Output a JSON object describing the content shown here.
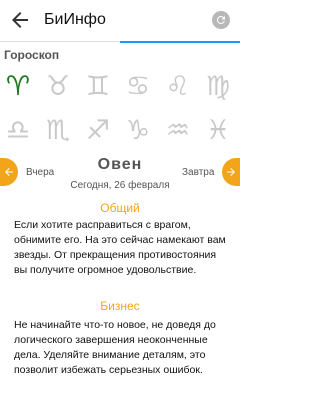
{
  "app": {
    "title": "БиИнфо"
  },
  "zodiac_section": {
    "title": "Гороскоп"
  },
  "zodiac_row1": [
    {
      "name": "aries",
      "glyph": "♈"
    },
    {
      "name": "taurus",
      "glyph": "♉"
    },
    {
      "name": "gemini",
      "glyph": "♊"
    },
    {
      "name": "cancer",
      "glyph": "♋"
    },
    {
      "name": "leo",
      "glyph": "♌"
    },
    {
      "name": "virgo",
      "glyph": "♍"
    }
  ],
  "zodiac_row2": [
    {
      "name": "libra",
      "glyph": "♎"
    },
    {
      "name": "scorpio",
      "glyph": "♏"
    },
    {
      "name": "sagittarius",
      "glyph": "♐"
    },
    {
      "name": "capricorn",
      "glyph": "♑"
    },
    {
      "name": "aquarius",
      "glyph": "♒"
    },
    {
      "name": "pisces",
      "glyph": "♓"
    }
  ],
  "selected_sign": "aries",
  "navigation": {
    "prev_label": "Вчера",
    "next_label": "Завтра"
  },
  "sign": {
    "name": "Овен",
    "date": "Сегодня, 26 февраля"
  },
  "sections": {
    "general": {
      "title": "Общий",
      "text": "Если хотите расправиться с врагом, обнимите его. На это сейчас намекают вам звезды. От прекращения противостояния вы получите огромное удовольствие."
    },
    "business": {
      "title": "Бизнес",
      "text": "Не начинайте что-то новое, не доведя до логического завершения неоконченные дела. Уделяйте внимание деталям, это позволит избежать серьезных ошибок."
    }
  },
  "colors": {
    "accent": "#f2a51a",
    "active_sign": "#1e7a1e",
    "tab_indicator": "#2196f3"
  }
}
